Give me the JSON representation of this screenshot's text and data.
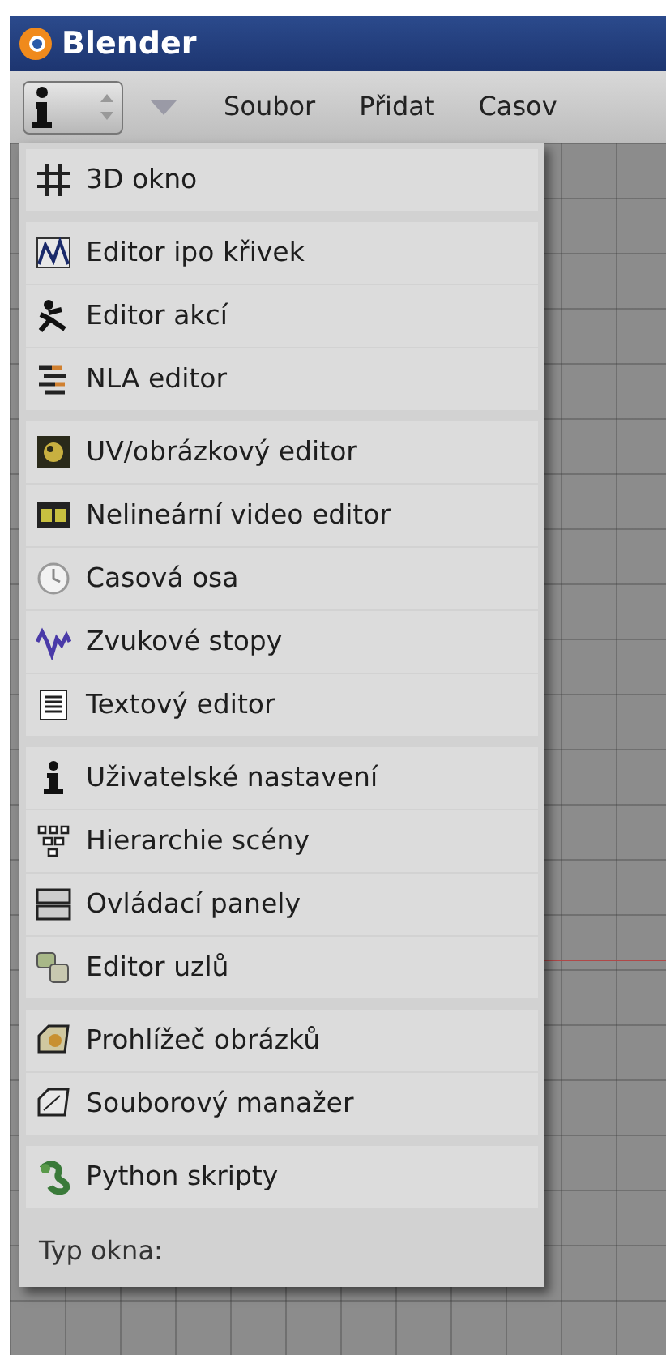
{
  "window": {
    "title": "Blender"
  },
  "header": {
    "menus": [
      "Soubor",
      "Přidat",
      "Casov"
    ]
  },
  "window_type_menu": {
    "groups": [
      {
        "items": [
          "3D okno"
        ]
      },
      {
        "items": [
          "Editor ipo křivek",
          "Editor akcí",
          "NLA editor"
        ]
      },
      {
        "items": [
          "UV/obrázkový editor",
          "Nelineární video editor",
          "Casová osa",
          "Zvukové stopy",
          "Textový editor"
        ]
      },
      {
        "items": [
          "Uživatelské nastavení",
          "Hierarchie scény",
          "Ovládací panely",
          "Editor uzlů"
        ]
      },
      {
        "items": [
          "Prohlížeč obrázků",
          "Souborový manažer"
        ]
      },
      {
        "items": [
          "Python skripty"
        ]
      }
    ],
    "title": "Typ okna:"
  }
}
